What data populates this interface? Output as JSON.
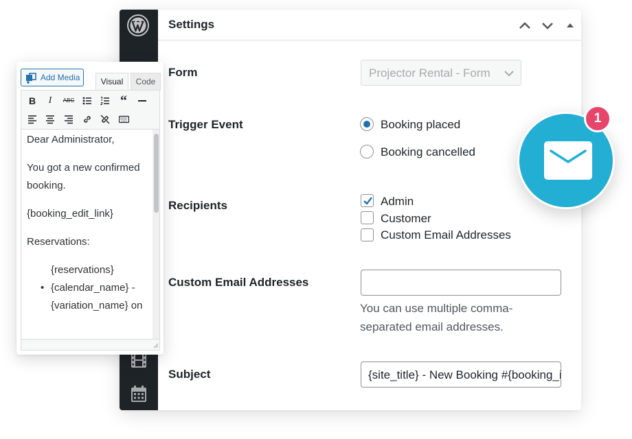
{
  "panel": {
    "title": "Settings",
    "header_buttons": [
      "chevron-up-icon",
      "chevron-down-icon",
      "triangle-up-icon"
    ],
    "sidebar_icons": [
      "wordpress-logo",
      "video-icon",
      "calendar-icon"
    ]
  },
  "form": {
    "label": "Form",
    "selected": "Projector Rental - Form"
  },
  "trigger": {
    "label": "Trigger Event",
    "options": [
      {
        "label": "Booking placed",
        "checked": true
      },
      {
        "label": "Booking cancelled",
        "checked": false
      }
    ]
  },
  "recipients": {
    "label": "Recipients",
    "options": [
      {
        "label": "Admin",
        "checked": true
      },
      {
        "label": "Customer",
        "checked": false
      },
      {
        "label": "Custom Email Addresses",
        "checked": false
      }
    ]
  },
  "custom_emails": {
    "label": "Custom Email Addresses",
    "value": "",
    "help": "You can use multiple comma-separated email addresses."
  },
  "subject": {
    "label": "Subject",
    "value": "{site_title} - New Booking #{booking_id}"
  },
  "notification": {
    "count": "1",
    "icon": "mail-icon",
    "color": "#23aed4",
    "badge_color": "#e8456b"
  },
  "editor": {
    "add_media": "Add Media",
    "tabs": [
      "Visual",
      "Code"
    ],
    "toolbar": [
      "bold-icon",
      "italic-icon",
      "strikethrough-icon",
      "bullet-list-icon",
      "numbered-list-icon",
      "blockquote-icon",
      "horizontal-line-icon",
      "align-left-icon",
      "align-center-icon",
      "align-right-icon",
      "link-icon",
      "unlink-icon",
      "keyboard-icon"
    ],
    "content": {
      "greeting": "Dear Administrator,",
      "line1": "You got a new confirmed booking.",
      "link_tag": "{booking_edit_link}",
      "reservations_label": "Reservations:",
      "reservations_tag": "{reservations}",
      "bullet_line": "{calendar_name} - {variation_name} on"
    }
  }
}
